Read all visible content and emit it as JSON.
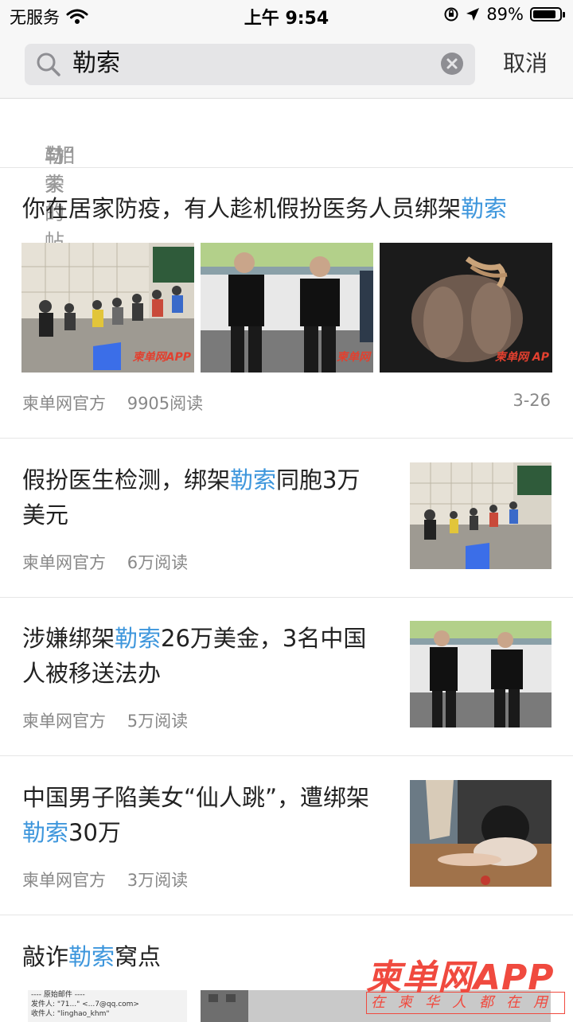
{
  "status_bar": {
    "carrier": "无服务",
    "time": "上午 9:54",
    "battery_percent": "89%",
    "battery_level": 0.89,
    "icons": [
      "wifi-icon",
      "orientation-lock-icon",
      "location-arrow-icon",
      "battery-icon"
    ]
  },
  "search": {
    "query": "勒索",
    "cancel_label": "取消",
    "icons": [
      "search-icon",
      "clear-icon"
    ]
  },
  "related_header": {
    "prefix": "与“",
    "keyword": "勒索",
    "suffix": "”相关的帖子"
  },
  "colors": {
    "highlight": "#3d96dc",
    "brand_red": "#f04a3f"
  },
  "articles": [
    {
      "title_before": "你在居家防疫，有人趁机假扮医务人员绑架",
      "title_highlight": "勒索",
      "title_after": "",
      "author": "柬单网官方",
      "reads": "9905阅读",
      "date": "3-26",
      "image_labels": [
        "柬单网APP",
        "柬单网",
        "柬单网 AP"
      ]
    },
    {
      "title_before": "假扮医生检测，绑架",
      "title_highlight": "勒索",
      "title_after": "同胞3万美元",
      "author": "柬单网官方",
      "reads": "6万阅读"
    },
    {
      "title_before": "涉嫌绑架",
      "title_highlight": "勒索",
      "title_after": "26万美金，3名中国人被移送法办",
      "author": "柬单网官方",
      "reads": "5万阅读"
    },
    {
      "title_before": "中国男子陷美女“仙人跳”，遭绑架",
      "title_highlight": "勒索",
      "title_after": "30万",
      "author": "柬单网官方",
      "reads": "3万阅读"
    },
    {
      "title_before": "敲诈",
      "title_highlight": "勒索",
      "title_after": "窝点",
      "mail_lines": [
        "---- 原始邮件 ----",
        "发件人: \"71...\" <...7@qq.com>",
        "收件人: \"linghao_khm\""
      ]
    }
  ],
  "watermark": {
    "brand": "柬单网APP",
    "tagline": "在柬华人都在用"
  }
}
